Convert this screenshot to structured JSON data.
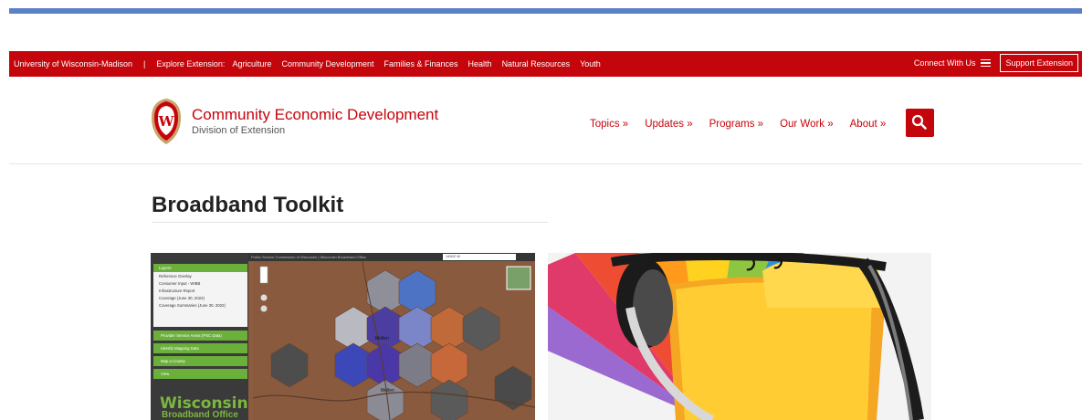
{
  "topbar": {
    "university": "University of Wisconsin-Madison",
    "separator": "|",
    "explore_label": "Explore Extension:",
    "links": [
      "Agriculture",
      "Community Development",
      "Families & Finances",
      "Health",
      "Natural Resources",
      "Youth"
    ],
    "connect": "Connect With Us",
    "support": "Support Extension"
  },
  "header": {
    "crest_letter": "W",
    "title": "Community Economic Development",
    "subtitle": "Division of Extension",
    "nav": [
      "Topics »",
      "Updates »",
      "Programs »",
      "Our Work »",
      "About »"
    ]
  },
  "main": {
    "title": "Broadband Toolkit"
  },
  "map_card": {
    "topbar_title": "Public Service Commission of Wisconsin | Wisconsin Broadband Office",
    "search_value": "14502 W",
    "layers_head": "Layers",
    "layers": [
      "Reference Overlay",
      "Consumer Input - WIBB",
      "Infrastructure Report",
      "Coverage (June 30, 2022)",
      "Coverage Summaries (June 30, 2022)"
    ],
    "panels": [
      "Provider Service Areas (PSC Data)",
      "Identify Mapping Data",
      "Map a County",
      "View"
    ],
    "logo_line1": "Wisconsin",
    "logo_line2": "Broadband Office",
    "place1": "Mellen",
    "place2": "Mellen"
  },
  "colors": {
    "brand_red": "#c5050c",
    "accent_blue": "#5b80c8",
    "map_green": "#6ab03a"
  }
}
